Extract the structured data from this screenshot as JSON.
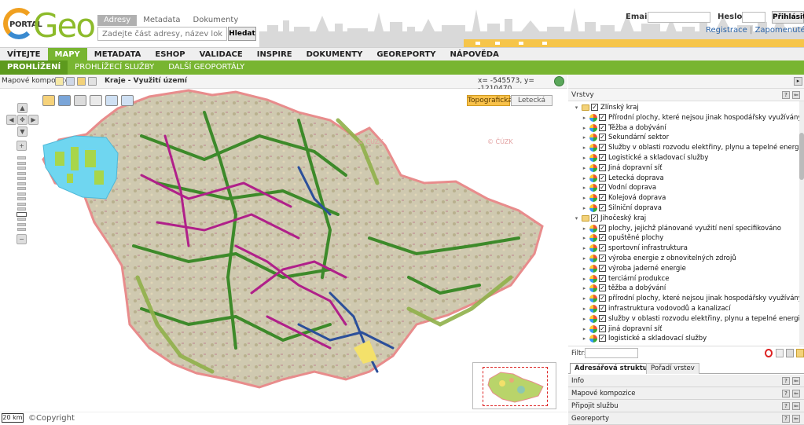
{
  "header": {
    "logo_portal": "PORTAL",
    "logo_geo": "Geo",
    "search_tabs": [
      "Adresy",
      "Metadata",
      "Dokumenty"
    ],
    "search_placeholder": "Zadejte část adresy, název lokality",
    "search_button": "Hledat",
    "email_label": "Email:",
    "password_label": "Heslo:",
    "login_button": "Přihlásit",
    "register_link": "Registrace",
    "register_sep": "|",
    "forgot_link": "Zapomenuté heslo"
  },
  "nav": {
    "items": [
      "VÍTEJTE",
      "MAPY",
      "METADATA",
      "ESHOP",
      "VALIDACE",
      "INSPIRE",
      "DOKUMENTY",
      "GEOREPORTY",
      "NÁPOVĚDA"
    ],
    "active": "MAPY"
  },
  "subnav": {
    "items": [
      "PROHLÍŽENÍ",
      "PROHLÍŽECÍ SLUŽBY",
      "DALŠÍ GEOPORTÁLY"
    ],
    "active": "PROHLÍŽENÍ"
  },
  "map_toolbar": {
    "compositions_label": "Mapové kompozice:",
    "composition_title": "Kraje - Využití území",
    "coords": "x= -545573, y= -1210470"
  },
  "map": {
    "topo_button": "Topografická",
    "aerial_button": "Letecká",
    "scale": "20 km",
    "copyright": "©Copyright",
    "zoom_levels": 15,
    "zoom_level": 11,
    "watermark": "© ČÚZK",
    "colors": {
      "region_outline": "#e88c8c",
      "region_fill": "#c9c2a8",
      "green_roads": "#3d8a2a",
      "magenta_roads": "#b0208a",
      "blue_roads": "#2b4f9a",
      "light_green": "#8fb04a",
      "prague_fill": "#6fd6f0",
      "topo_button": "#f8c14a"
    }
  },
  "layers_panel": {
    "title": "Vrstvy",
    "tree": [
      {
        "level": 0,
        "label": "Zlínský kraj",
        "type": "folder"
      },
      {
        "level": 1,
        "label": "Přírodní plochy, které nejsou jinak hospodářsky využívány"
      },
      {
        "level": 1,
        "label": "Těžba a dobývání"
      },
      {
        "level": 1,
        "label": "Sekundární sektor"
      },
      {
        "level": 1,
        "label": "Služby v oblasti rozvodu elektřiny, plynu a tepelné energie"
      },
      {
        "level": 1,
        "label": "Logistické a skladovací služby"
      },
      {
        "level": 1,
        "label": "Jiná dopravní síť"
      },
      {
        "level": 1,
        "label": "Letecká doprava"
      },
      {
        "level": 1,
        "label": "Vodní doprava"
      },
      {
        "level": 1,
        "label": "Kolejová doprava"
      },
      {
        "level": 1,
        "label": "Silniční doprava"
      },
      {
        "level": 0,
        "label": "Jihočeský kraj",
        "type": "folder"
      },
      {
        "level": 1,
        "label": "plochy, jejichž plánované využití není specifikováno"
      },
      {
        "level": 1,
        "label": "opuštěné plochy"
      },
      {
        "level": 1,
        "label": "sportovní infrastruktura"
      },
      {
        "level": 1,
        "label": "výroba energie z obnovitelných zdrojů"
      },
      {
        "level": 1,
        "label": "výroba jaderné energie"
      },
      {
        "level": 1,
        "label": "terciární produkce"
      },
      {
        "level": 1,
        "label": "těžba a dobývání"
      },
      {
        "level": 1,
        "label": "přírodní plochy, které nejsou jinak hospodářsky využívány"
      },
      {
        "level": 1,
        "label": "infrastruktura vodovodů a kanalizací"
      },
      {
        "level": 1,
        "label": "služby v oblasti rozvodu elektřiny, plynu a tepelné energie"
      },
      {
        "level": 1,
        "label": "jiná dopravní síť"
      },
      {
        "level": 1,
        "label": "logistické a skladovací služby"
      }
    ],
    "filter_label": "Filtr:",
    "tabs": [
      "Adresářová struktura",
      "Pořadí vrstev"
    ],
    "active_tab": "Adresářová struktura"
  },
  "accordion": [
    "Info",
    "Mapové kompozice",
    "Připojit službu",
    "Georeporty"
  ]
}
